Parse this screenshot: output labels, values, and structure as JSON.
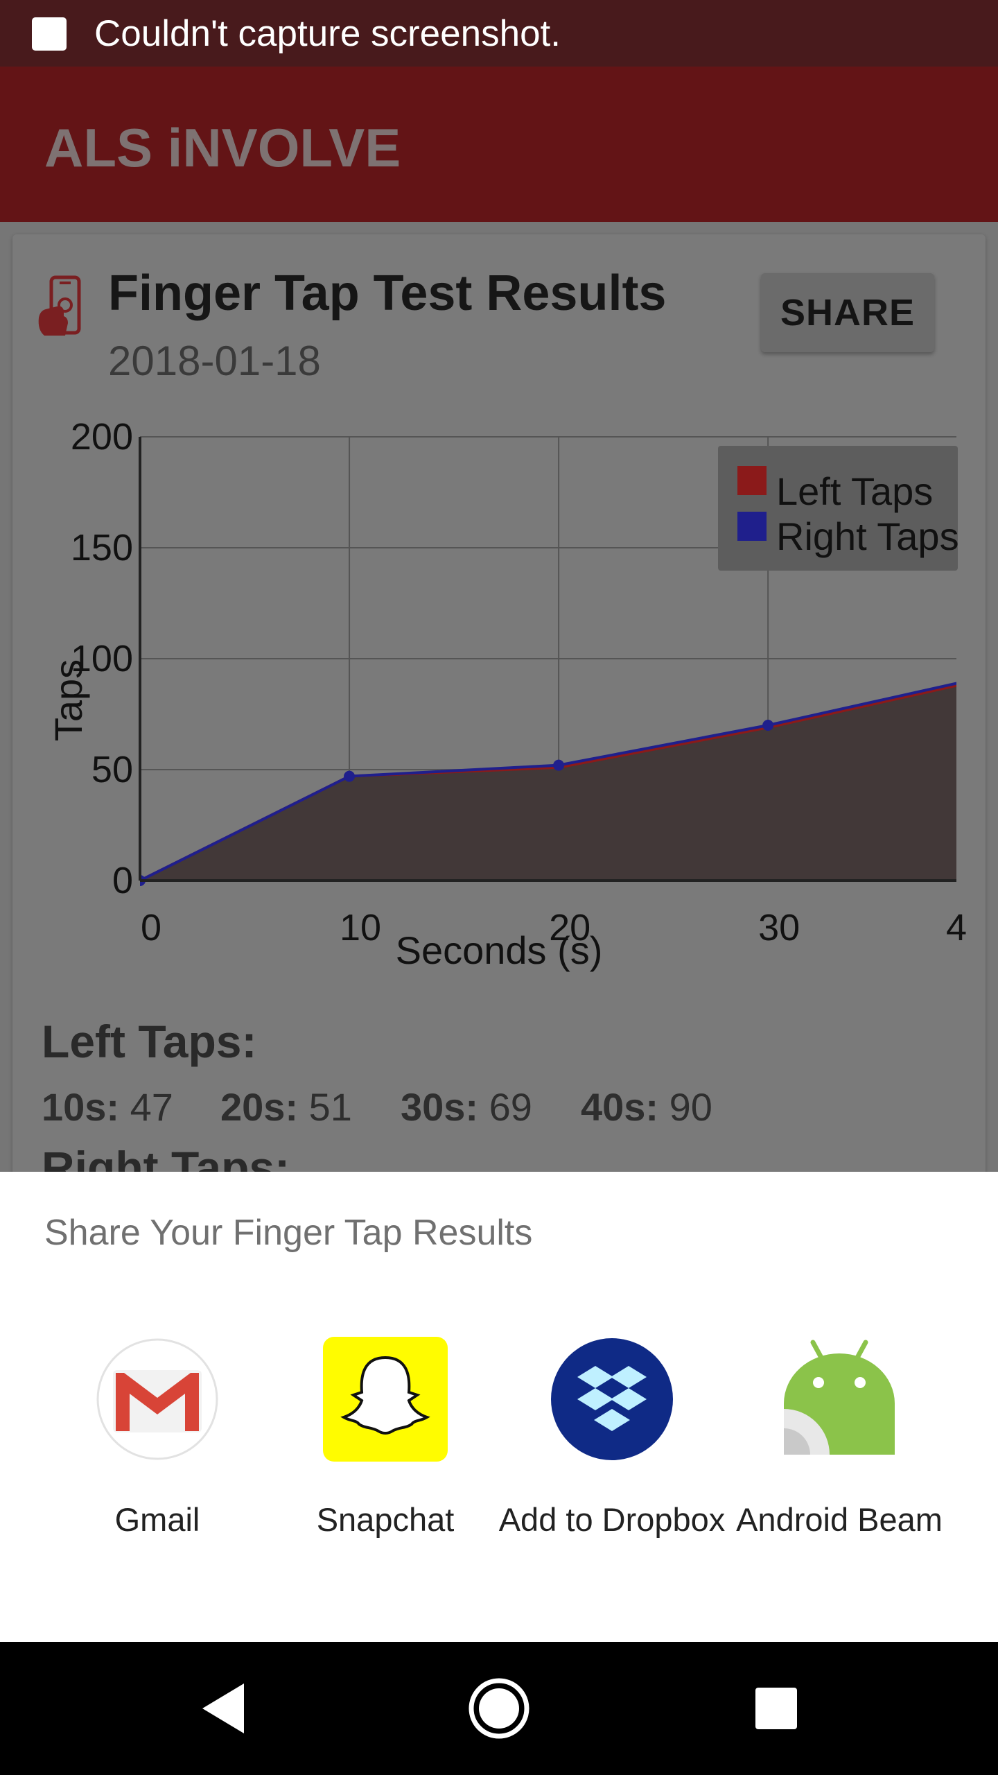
{
  "status_bar": {
    "notification": "Couldn't capture screenshot."
  },
  "app_bar": {
    "title": "ALS iNVOLVE"
  },
  "card": {
    "title": "Finger Tap Test Results",
    "date": "2018-01-18",
    "share_label": "SHARE"
  },
  "chart_data": {
    "type": "area",
    "xlabel": "Seconds (s)",
    "ylabel": "Taps",
    "x": [
      0,
      10,
      20,
      30,
      40
    ],
    "x_tick_labels": [
      "0",
      "10",
      "20",
      "30",
      "4"
    ],
    "y_ticks": [
      0,
      50,
      100,
      150,
      200
    ],
    "xlim": [
      0,
      39
    ],
    "ylim": [
      0,
      200
    ],
    "grid": true,
    "legend_position": "top-right",
    "series": [
      {
        "name": "Left Taps",
        "values": [
          0,
          47,
          51,
          69,
          90
        ],
        "color": "#8b1a1a"
      },
      {
        "name": "Right Taps",
        "values": [
          0,
          47,
          52,
          70,
          91
        ],
        "color": "#1f1f8c"
      }
    ]
  },
  "left_taps": {
    "title": "Left Taps:",
    "items": [
      {
        "label": "10s:",
        "value": "47"
      },
      {
        "label": "20s:",
        "value": "51"
      },
      {
        "label": "30s:",
        "value": "69"
      },
      {
        "label": "40s:",
        "value": "90"
      }
    ]
  },
  "right_taps": {
    "title": "Right Taps:"
  },
  "share_sheet": {
    "title": "Share Your Finger Tap Results",
    "apps": [
      {
        "label": "Gmail",
        "icon": "gmail-icon"
      },
      {
        "label": "Snapchat",
        "icon": "snapchat-icon"
      },
      {
        "label": "Add to Dropbox",
        "icon": "dropbox-icon"
      },
      {
        "label": "Android Beam",
        "icon": "android-beam-icon"
      }
    ]
  },
  "nav": {
    "back": "back-icon",
    "home": "home-icon",
    "recents": "recents-icon"
  }
}
